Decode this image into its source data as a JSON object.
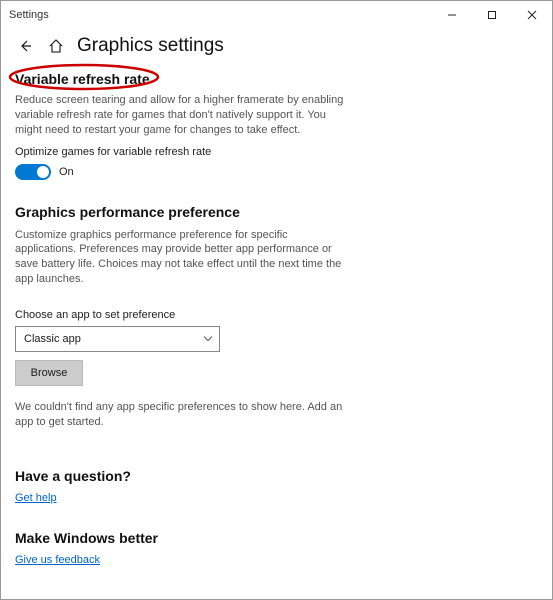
{
  "window": {
    "title": "Settings"
  },
  "page": {
    "title": "Graphics settings"
  },
  "vrr": {
    "heading": "Variable refresh rate",
    "desc": "Reduce screen tearing and allow for a higher framerate by enabling variable refresh rate for games that don't natively support it. You might need to restart your game for changes to take effect.",
    "optimize_label": "Optimize games for variable refresh rate",
    "toggle_state": "On"
  },
  "perf": {
    "heading": "Graphics performance preference",
    "desc": "Customize graphics performance preference for specific applications. Preferences may provide better app performance or save battery life. Choices may not take effect until the next time the app launches.",
    "choose_label": "Choose an app to set preference",
    "select_value": "Classic app",
    "browse_label": "Browse",
    "empty_msg": "We couldn't find any app specific preferences to show here. Add an app to get started."
  },
  "help": {
    "heading": "Have a question?",
    "link": "Get help"
  },
  "feedback": {
    "heading": "Make Windows better",
    "link": "Give us feedback"
  }
}
